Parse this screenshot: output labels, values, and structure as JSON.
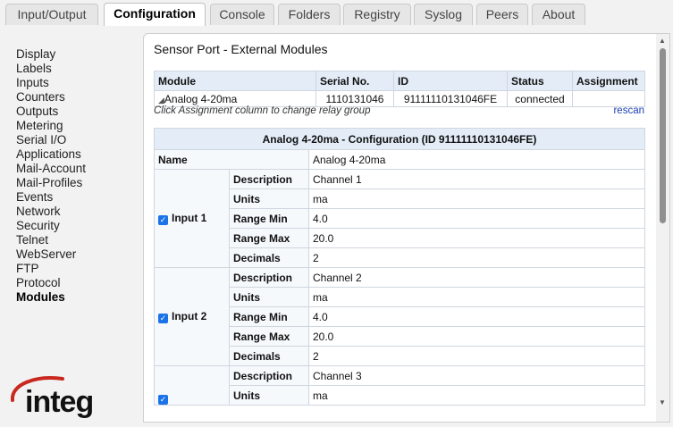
{
  "tabs": [
    {
      "label": "Input/Output"
    },
    {
      "label": "Configuration"
    },
    {
      "label": "Console"
    },
    {
      "label": "Folders"
    },
    {
      "label": "Registry"
    },
    {
      "label": "Syslog"
    },
    {
      "label": "Peers"
    },
    {
      "label": "About"
    }
  ],
  "sidebar": {
    "items": [
      {
        "label": "Display"
      },
      {
        "label": "Labels"
      },
      {
        "label": "Inputs"
      },
      {
        "label": "Counters"
      },
      {
        "label": "Outputs"
      },
      {
        "label": "Metering"
      },
      {
        "label": "Serial I/O"
      },
      {
        "label": "Applications"
      },
      {
        "label": "Mail-Account"
      },
      {
        "label": "Mail-Profiles"
      },
      {
        "label": "Events"
      },
      {
        "label": "Network"
      },
      {
        "label": "Security"
      },
      {
        "label": "Telnet"
      },
      {
        "label": "WebServer"
      },
      {
        "label": "FTP"
      },
      {
        "label": "Protocol"
      },
      {
        "label": "Modules"
      }
    ]
  },
  "logo": {
    "text": "integ"
  },
  "main": {
    "title": "Sensor Port - External Modules",
    "modules": {
      "headers": [
        "Module",
        "Serial No.",
        "ID",
        "Status",
        "Assignment"
      ],
      "row": {
        "module": "Analog 4-20ma",
        "serial": "1110131046",
        "id": "91111110131046FE",
        "status": "connected",
        "assignment": ""
      },
      "hint": "Click Assignment column to change relay group",
      "rescan": "rescan"
    },
    "config": {
      "title": "Analog 4-20ma - Configuration (ID 91111110131046FE)",
      "name_label": "Name",
      "name_value": "Analog 4-20ma",
      "field_labels": {
        "description": "Description",
        "units": "Units",
        "range_min": "Range Min",
        "range_max": "Range Max",
        "decimals": "Decimals"
      },
      "inputs": [
        {
          "label": "Input 1",
          "checked": true,
          "description": "Channel 1",
          "units": "ma",
          "range_min": "4.0",
          "range_max": "20.0",
          "decimals": "2"
        },
        {
          "label": "Input 2",
          "checked": true,
          "description": "Channel 2",
          "units": "ma",
          "range_min": "4.0",
          "range_max": "20.0",
          "decimals": "2"
        },
        {
          "label": "",
          "checked": true,
          "description": "Channel 3",
          "units": "ma"
        }
      ]
    }
  },
  "colors": {
    "accent": "#1a73e8",
    "link": "#1a3fb5",
    "header_bg": "#e3ecf7",
    "logo_red": "#c8281e"
  }
}
